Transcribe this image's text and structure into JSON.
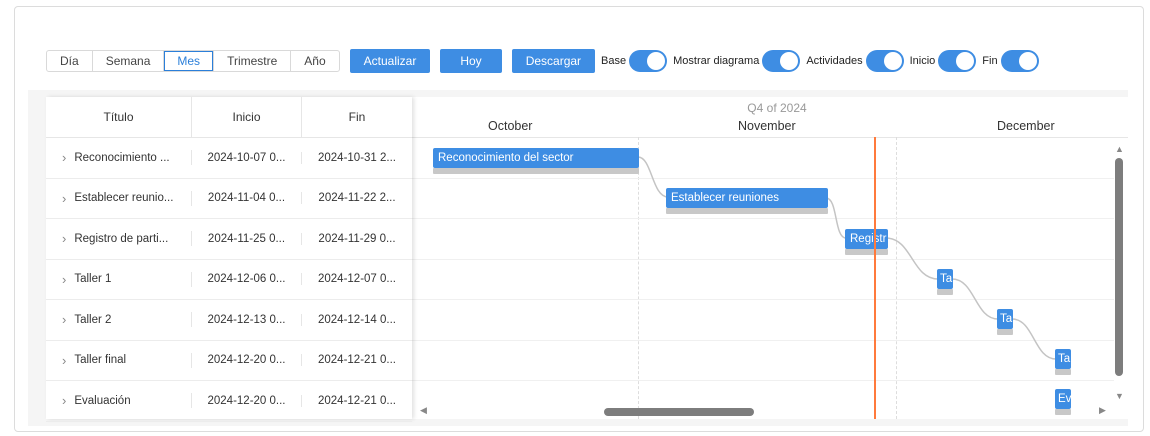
{
  "toolbar": {
    "views": [
      "Día",
      "Semana",
      "Mes",
      "Trimestre",
      "Año"
    ],
    "active_view": "Mes",
    "actualizar": "Actualizar",
    "hoy": "Hoy",
    "descargar": "Descargar",
    "toggles": [
      {
        "label": "Base",
        "on": true
      },
      {
        "label": "Mostrar diagrama",
        "on": true
      },
      {
        "label": "Actividades",
        "on": true
      },
      {
        "label": "Inicio",
        "on": true
      },
      {
        "label": "Fin",
        "on": true
      }
    ]
  },
  "grid": {
    "headers": [
      "Título",
      "Inicio",
      "Fin"
    ],
    "rows": [
      {
        "title": "Reconocimiento ...",
        "start": "2024-10-07 0...",
        "end": "2024-10-31 2..."
      },
      {
        "title": "Establecer reunio...",
        "start": "2024-11-04 0...",
        "end": "2024-11-22 2..."
      },
      {
        "title": "Registro de parti...",
        "start": "2024-11-25 0...",
        "end": "2024-11-29 0..."
      },
      {
        "title": "Taller 1",
        "start": "2024-12-06 0...",
        "end": "2024-12-07 0..."
      },
      {
        "title": "Taller 2",
        "start": "2024-12-13 0...",
        "end": "2024-12-14 0..."
      },
      {
        "title": "Taller final",
        "start": "2024-12-20 0...",
        "end": "2024-12-21 0..."
      },
      {
        "title": "Evaluación",
        "start": "2024-12-20 0...",
        "end": "2024-12-21 0..."
      }
    ]
  },
  "timeline": {
    "quarter": "Q4 of 2024",
    "months": [
      "October",
      "November",
      "December"
    ],
    "bars": [
      "Reconocimiento del sector",
      "Establecer reuniones",
      "Registr",
      "Ta",
      "Ta",
      "Ta",
      "Ev"
    ]
  },
  "colors": {
    "accent": "#3e8de3",
    "today": "#ff7a3c",
    "baseline": "#c8c8c8"
  }
}
